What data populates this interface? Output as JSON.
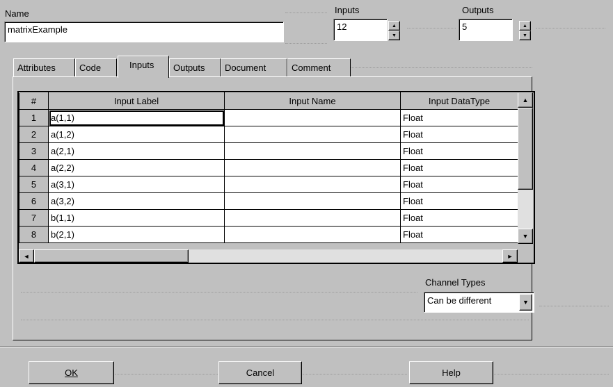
{
  "name": {
    "label": "Name",
    "value": "matrixExample"
  },
  "inputs": {
    "label": "Inputs",
    "value": "12"
  },
  "outputs": {
    "label": "Outputs",
    "value": "5"
  },
  "tabs": [
    {
      "label": "Attributes"
    },
    {
      "label": "Code"
    },
    {
      "label": "Inputs"
    },
    {
      "label": "Outputs"
    },
    {
      "label": "Document"
    },
    {
      "label": "Comment"
    }
  ],
  "active_tab": "Inputs",
  "grid": {
    "columns": [
      "#",
      "Input Label",
      "Input Name",
      "Input DataType"
    ],
    "rows": [
      {
        "num": "1",
        "label": "a(1,1)",
        "name": "",
        "type": "Float"
      },
      {
        "num": "2",
        "label": "a(1,2)",
        "name": "",
        "type": "Float"
      },
      {
        "num": "3",
        "label": "a(2,1)",
        "name": "",
        "type": "Float"
      },
      {
        "num": "4",
        "label": "a(2,2)",
        "name": "",
        "type": "Float"
      },
      {
        "num": "5",
        "label": "a(3,1)",
        "name": "",
        "type": "Float"
      },
      {
        "num": "6",
        "label": "a(3,2)",
        "name": "",
        "type": "Float"
      },
      {
        "num": "7",
        "label": "b(1,1)",
        "name": "",
        "type": "Float"
      },
      {
        "num": "8",
        "label": "b(2,1)",
        "name": "",
        "type": "Float"
      }
    ]
  },
  "channel_types": {
    "label": "Channel Types",
    "value": "Can be different"
  },
  "buttons": {
    "ok": "OK",
    "cancel": "Cancel",
    "help": "Help"
  },
  "icons": {
    "up": "▲",
    "down": "▼",
    "left": "◄",
    "right": "►"
  }
}
